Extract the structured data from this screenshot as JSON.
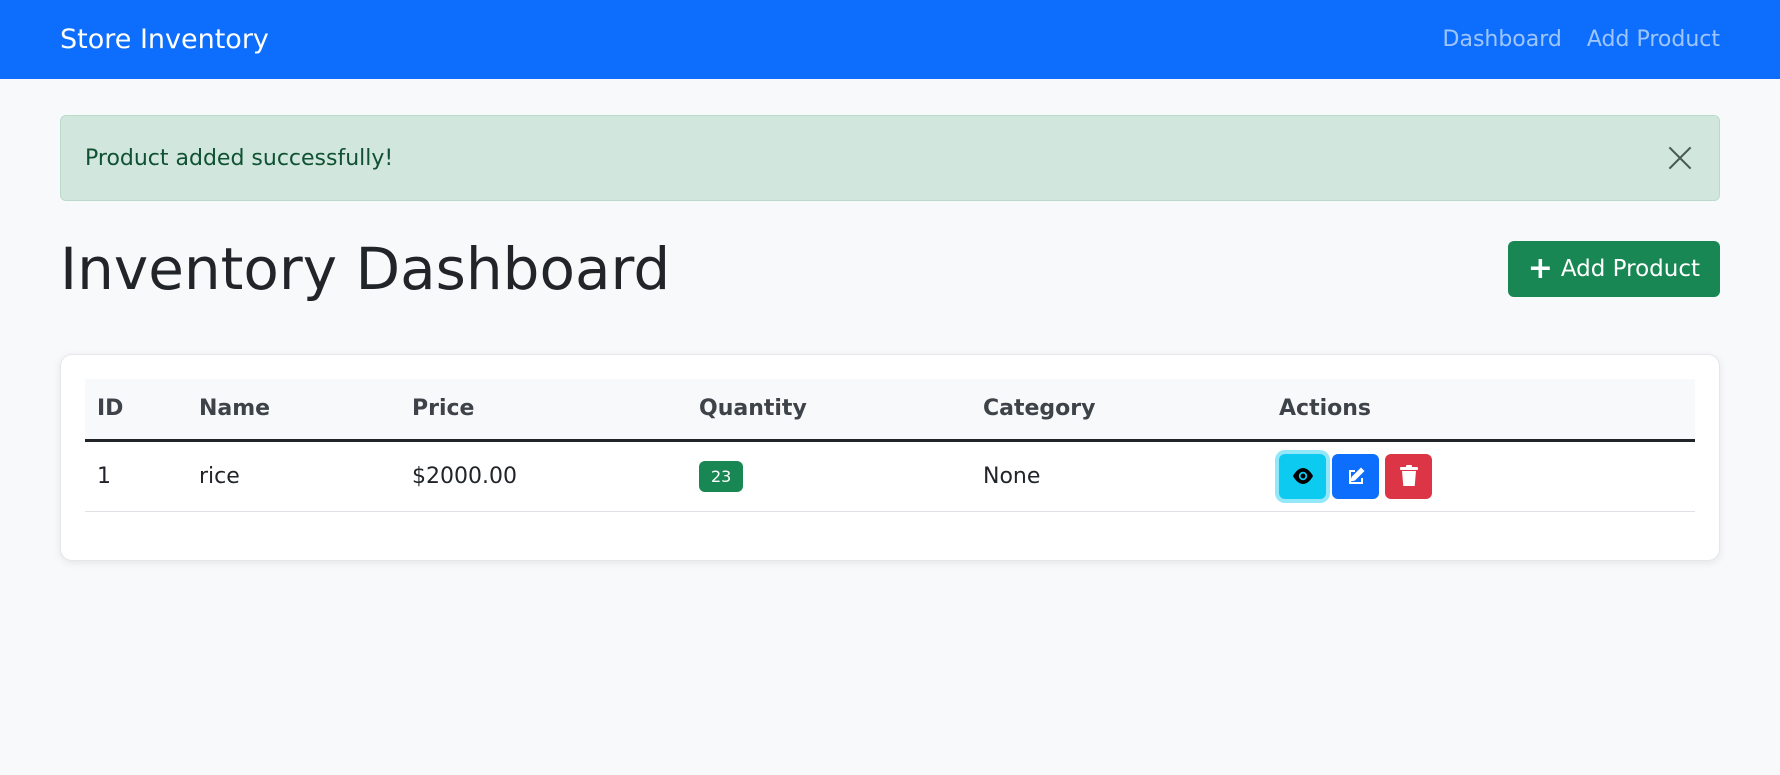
{
  "navbar": {
    "brand": "Store Inventory",
    "links": [
      "Dashboard",
      "Add Product"
    ]
  },
  "alert": {
    "message": "Product added successfully!"
  },
  "page": {
    "title": "Inventory Dashboard",
    "add_button_label": "Add Product"
  },
  "table": {
    "headers": [
      "ID",
      "Name",
      "Price",
      "Quantity",
      "Category",
      "Actions"
    ],
    "rows": [
      {
        "id": "1",
        "name": "rice",
        "price": "$2000.00",
        "quantity": "23",
        "category": "None"
      }
    ]
  },
  "icons": {
    "view": "eye-icon",
    "edit": "edit-icon",
    "delete": "trash-icon",
    "add": "plus-icon",
    "close": "close-icon"
  },
  "colors": {
    "primary": "#0d6efd",
    "success": "#198754",
    "info": "#0dcaf0",
    "danger": "#dc3545",
    "alert_bg": "#d1e7dd"
  }
}
